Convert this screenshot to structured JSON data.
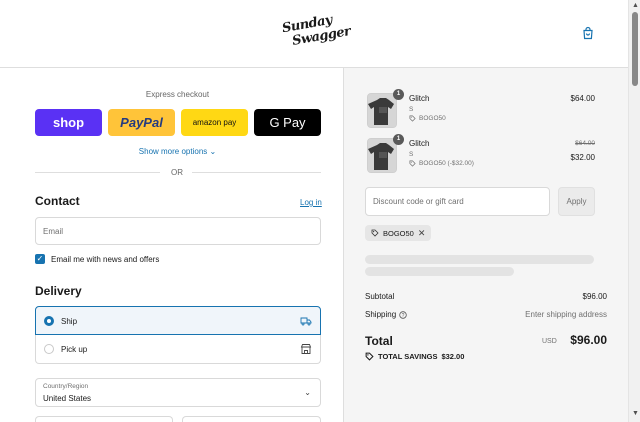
{
  "header": {
    "logo_line1": "Sunday",
    "logo_line2": "Swagger",
    "cart_icon": "shopping-bag-icon"
  },
  "express": {
    "title": "Express checkout",
    "buttons": {
      "shop": "shop",
      "paypal": "PayPal",
      "amazon": "amazon pay",
      "gpay": "G Pay"
    },
    "more_options": "Show more options",
    "or": "OR"
  },
  "contact": {
    "title": "Contact",
    "login": "Log in",
    "email_placeholder": "Email",
    "newsletter_label": "Email me with news and offers",
    "newsletter_checked": true
  },
  "delivery": {
    "title": "Delivery",
    "options": [
      {
        "label": "Ship",
        "selected": true,
        "icon": "truck-icon"
      },
      {
        "label": "Pick up",
        "selected": false,
        "icon": "store-icon"
      }
    ],
    "country_label": "Country/Region",
    "country_value": "United States"
  },
  "cart": {
    "items": [
      {
        "name": "Glitch",
        "variant": "S",
        "qty": "1",
        "discount": "BOGO50",
        "price": "$64.00"
      },
      {
        "name": "Glitch",
        "variant": "S",
        "qty": "1",
        "discount": "BOGO50 (-$32.00)",
        "original_price": "$64.00",
        "price": "$32.00"
      }
    ],
    "discount_placeholder": "Discount code or gift card",
    "apply_label": "Apply",
    "applied_code": "BOGO50",
    "subtotal_label": "Subtotal",
    "subtotal_value": "$96.00",
    "shipping_label": "Shipping",
    "shipping_value": "Enter shipping address",
    "total_label": "Total",
    "currency": "USD",
    "total_value": "$96.00",
    "savings_label": "TOTAL SAVINGS",
    "savings_value": "$32.00"
  },
  "colors": {
    "accent": "#1773b0",
    "shop_purple": "#5a31f4",
    "paypal_yellow": "#ffc439",
    "amazon_yellow": "#ffd814"
  }
}
